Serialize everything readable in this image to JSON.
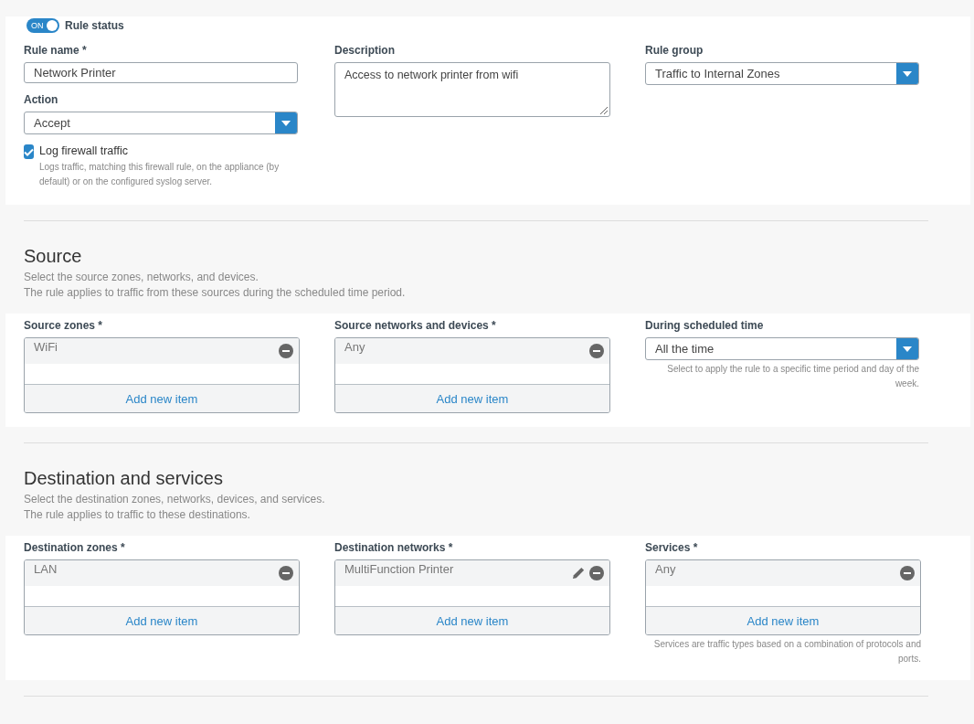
{
  "rule_status": {
    "toggle_label": "ON",
    "on": true,
    "label": "Rule status"
  },
  "general": {
    "rule_name": {
      "label": "Rule name *",
      "value": "Network Printer"
    },
    "action": {
      "label": "Action",
      "value": "Accept"
    },
    "log": {
      "label": "Log firewall traffic",
      "checked": true,
      "hint": "Logs traffic, matching this firewall rule, on the appliance (by default) or on the configured syslog server."
    },
    "description": {
      "label": "Description",
      "value": "Access to network printer from wifi"
    },
    "rule_group": {
      "label": "Rule group",
      "value": "Traffic to Internal Zones"
    }
  },
  "sections": [
    {
      "title": "Source",
      "subtitle_lines": [
        "Select the source zones, networks, and devices.",
        "The rule applies to traffic from these sources during the scheduled time period."
      ],
      "fields": [
        {
          "kind": "list",
          "label": "Source zones *",
          "items": [
            {
              "text": "WiFi",
              "editable": false
            }
          ],
          "add_label": "Add new item"
        },
        {
          "kind": "list",
          "label": "Source networks and devices *",
          "items": [
            {
              "text": "Any",
              "editable": false
            }
          ],
          "add_label": "Add new item"
        },
        {
          "kind": "select",
          "label": "During scheduled time",
          "value": "All the time",
          "hint": "Select to apply the rule to a specific time period and day of the week."
        }
      ]
    },
    {
      "title": "Destination and services",
      "subtitle_lines": [
        "Select the destination zones, networks, devices, and services.",
        "The rule applies to traffic to these destinations."
      ],
      "fields": [
        {
          "kind": "list",
          "label": "Destination zones *",
          "items": [
            {
              "text": "LAN",
              "editable": false
            }
          ],
          "add_label": "Add new item"
        },
        {
          "kind": "list",
          "label": "Destination networks *",
          "items": [
            {
              "text": "MultiFunction Printer",
              "editable": true
            }
          ],
          "add_label": "Add new item"
        },
        {
          "kind": "list",
          "label": "Services *",
          "items": [
            {
              "text": "Any",
              "editable": false
            }
          ],
          "add_label": "Add new item",
          "hint": "Services are traffic types based on a combination of protocols and ports."
        }
      ]
    }
  ]
}
